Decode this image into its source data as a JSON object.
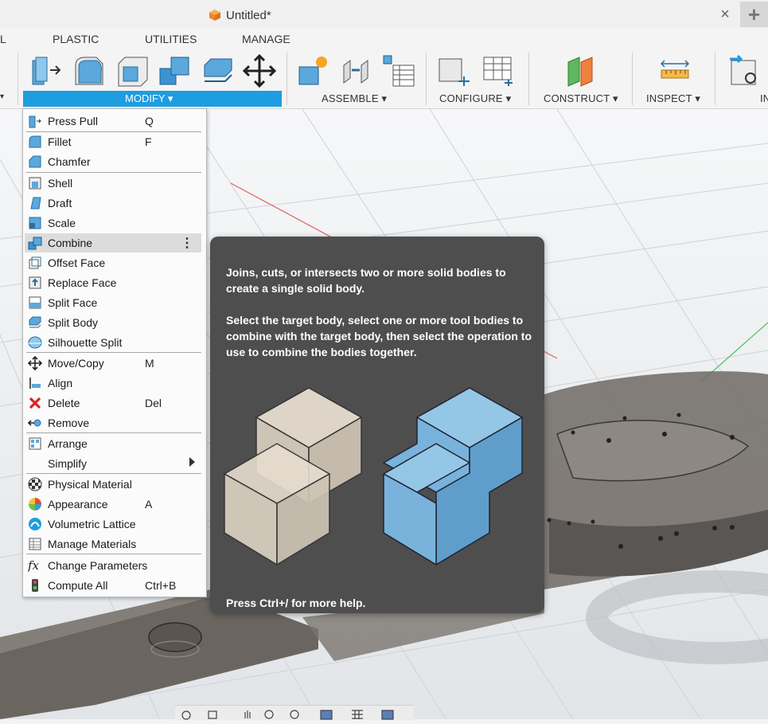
{
  "document": {
    "title": "Untitled*",
    "close_symbol": "×",
    "new_tab_symbol": "+"
  },
  "ribbon": {
    "tabs": [
      "L",
      "PLASTIC",
      "UTILITIES",
      "MANAGE"
    ],
    "groups": {
      "modify": "MODIFY ▾",
      "assemble": "ASSEMBLE ▾",
      "configure": "CONFIGURE ▾",
      "construct": "CONSTRUCT ▾",
      "inspect": "INSPECT ▾",
      "insert_partial": "IN"
    },
    "left_arrow": "▾"
  },
  "modify_menu": {
    "items": [
      {
        "label": "Press Pull",
        "shortcut": "Q",
        "icon": "press-pull-icon"
      },
      {
        "label": "Fillet",
        "shortcut": "F",
        "icon": "fillet-icon"
      },
      {
        "label": "Chamfer",
        "shortcut": "",
        "icon": "chamfer-icon"
      },
      {
        "label": "Shell",
        "shortcut": "",
        "icon": "shell-icon"
      },
      {
        "label": "Draft",
        "shortcut": "",
        "icon": "draft-icon"
      },
      {
        "label": "Scale",
        "shortcut": "",
        "icon": "scale-icon"
      },
      {
        "label": "Combine",
        "shortcut": "",
        "icon": "combine-icon"
      },
      {
        "label": "Offset Face",
        "shortcut": "",
        "icon": "offset-face-icon"
      },
      {
        "label": "Replace Face",
        "shortcut": "",
        "icon": "replace-face-icon"
      },
      {
        "label": "Split Face",
        "shortcut": "",
        "icon": "split-face-icon"
      },
      {
        "label": "Split Body",
        "shortcut": "",
        "icon": "split-body-icon"
      },
      {
        "label": "Silhouette Split",
        "shortcut": "",
        "icon": "silhouette-split-icon"
      },
      {
        "label": "Move/Copy",
        "shortcut": "M",
        "icon": "move-copy-icon"
      },
      {
        "label": "Align",
        "shortcut": "",
        "icon": "align-icon"
      },
      {
        "label": "Delete",
        "shortcut": "Del",
        "icon": "delete-icon"
      },
      {
        "label": "Remove",
        "shortcut": "",
        "icon": "remove-icon"
      },
      {
        "label": "Arrange",
        "shortcut": "",
        "icon": "arrange-icon"
      },
      {
        "label": "Simplify",
        "shortcut": "",
        "icon": "simplify-icon"
      },
      {
        "label": "Physical Material",
        "shortcut": "",
        "icon": "physical-material-icon"
      },
      {
        "label": "Appearance",
        "shortcut": "A",
        "icon": "appearance-icon"
      },
      {
        "label": "Volumetric Lattice",
        "shortcut": "",
        "icon": "volumetric-lattice-icon"
      },
      {
        "label": "Manage Materials",
        "shortcut": "",
        "icon": "manage-materials-icon"
      },
      {
        "label": "Change Parameters",
        "shortcut": "",
        "icon": "change-parameters-icon"
      },
      {
        "label": "Compute All",
        "shortcut": "Ctrl+B",
        "icon": "compute-all-icon"
      }
    ],
    "highlighted_more_symbol": "⋮"
  },
  "tooltip": {
    "description": "Joins, cuts, or intersects two or more solid bodies to create a single solid body.",
    "instructions": "Select the target body, select one or more tool bodies to combine with the target body, then select the operation to use to combine the bodies together.",
    "help_hint": "Press Ctrl+/ for more help."
  },
  "colors": {
    "accent": "#1e9de0",
    "tooltip_bg": "#4e4e4e",
    "menu_highlight": "#dcdcdc"
  }
}
